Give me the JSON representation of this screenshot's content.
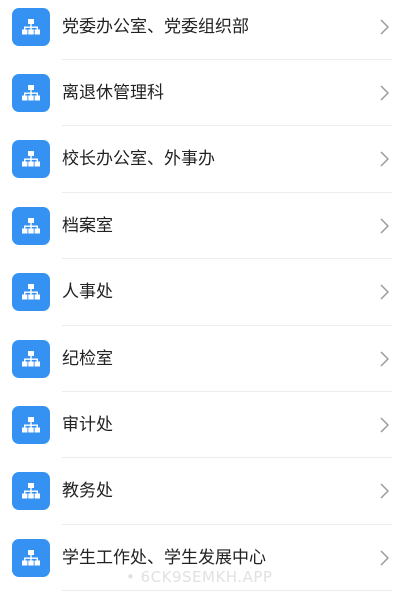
{
  "colors": {
    "icon_bg": "#3592f3",
    "text": "#222222",
    "chevron": "#9a9a9a",
    "divider": "#ececec"
  },
  "items": [
    {
      "label": "党委办公室、党委组织部",
      "icon": "org-chart-icon"
    },
    {
      "label": "离退休管理科",
      "icon": "org-chart-icon"
    },
    {
      "label": "校长办公室、外事办",
      "icon": "org-chart-icon"
    },
    {
      "label": "档案室",
      "icon": "org-chart-icon"
    },
    {
      "label": "人事处",
      "icon": "org-chart-icon"
    },
    {
      "label": "纪检室",
      "icon": "org-chart-icon"
    },
    {
      "label": "审计处",
      "icon": "org-chart-icon"
    },
    {
      "label": "教务处",
      "icon": "org-chart-icon"
    },
    {
      "label": "学生工作处、学生发展中心",
      "icon": "org-chart-icon"
    }
  ],
  "watermark": "• 6CK9SEMKH.APP"
}
